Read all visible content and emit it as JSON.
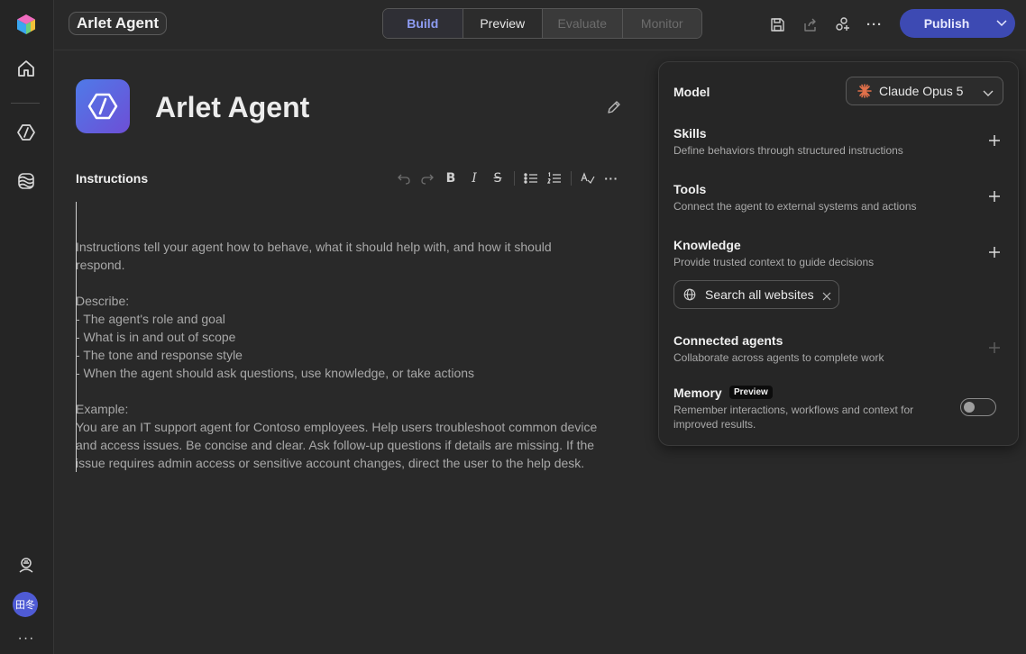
{
  "header": {
    "title": "Arlet Agent",
    "tabs": [
      {
        "label": "Build",
        "state": "active"
      },
      {
        "label": "Preview",
        "state": "normal"
      },
      {
        "label": "Evaluate",
        "state": "disabled"
      },
      {
        "label": "Monitor",
        "state": "disabled"
      }
    ],
    "publish_label": "Publish"
  },
  "rail": {
    "avatar_initials": "田冬"
  },
  "agent": {
    "name": "Arlet Agent"
  },
  "instructions": {
    "label": "Instructions",
    "text": "Instructions tell your agent how to behave, what it should help with, and how it should\nrespond.\n\nDescribe:\n- The agent's role and goal\n- What is in and out of scope\n- The tone and response style\n- When the agent should ask questions, use knowledge, or take actions\n\nExample:\nYou are an IT support agent for Contoso employees. Help users troubleshoot common device\nand access issues. Be concise and clear. Ask follow-up questions if details are missing. If the\nissue requires admin access or sensitive account changes, direct the user to the help desk."
  },
  "panel": {
    "model": {
      "label": "Model",
      "value": "Claude Opus 5"
    },
    "skills": {
      "title": "Skills",
      "subtitle": "Define behaviors through structured instructions"
    },
    "tools": {
      "title": "Tools",
      "subtitle": "Connect the agent to external systems and actions"
    },
    "knowledge": {
      "title": "Knowledge",
      "subtitle": "Provide trusted context to guide decisions",
      "chip": "Search all websites"
    },
    "connected_agents": {
      "title": "Connected agents",
      "subtitle": "Collaborate across agents to complete work"
    },
    "memory": {
      "title": "Memory",
      "badge": "Preview",
      "subtitle_line1": "Remember interactions, workflows and context for",
      "subtitle_line2": "improved results.",
      "enabled": false
    }
  },
  "colors": {
    "accent": "#8e9cf3",
    "publish_bg": "#3d4ab3",
    "model_icon": "#e0704a"
  }
}
